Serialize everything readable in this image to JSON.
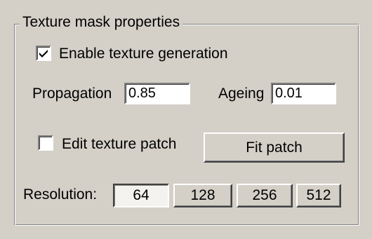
{
  "group": {
    "title": "Texture mask properties"
  },
  "enable_texture": {
    "label": "Enable texture generation",
    "checked": true
  },
  "propagation": {
    "label": "Propagation",
    "value": "0.85"
  },
  "ageing": {
    "label": "Ageing",
    "value": "0.01"
  },
  "edit_patch": {
    "label": "Edit texture patch",
    "checked": false
  },
  "fit_patch": {
    "label": "Fit patch"
  },
  "resolution": {
    "label": "Resolution:",
    "options": [
      "64",
      "128",
      "256",
      "512"
    ],
    "selected": "64"
  },
  "icons": {
    "checkmark": "checkmark-icon"
  },
  "colors": {
    "face": "#d4d0c8",
    "highlight": "#ffffff",
    "shadow": "#808080",
    "dark_shadow": "#404040"
  }
}
